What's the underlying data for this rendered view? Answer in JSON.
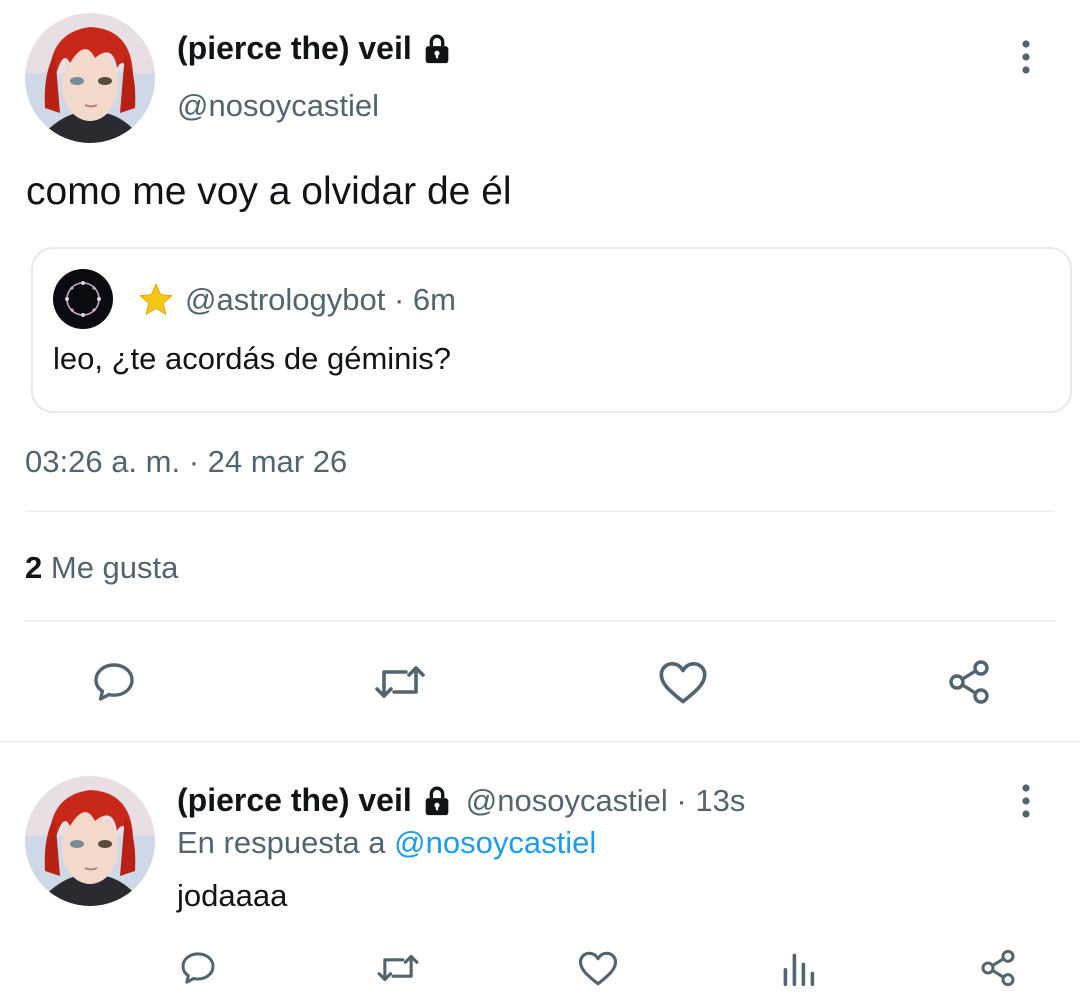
{
  "main_tweet": {
    "display_name": "(pierce the) veil",
    "handle": "@nosoycastiel",
    "text": "como me voy a olvidar de él",
    "quoted": {
      "handle_time": "@astrologybot · 6m",
      "text": "leo, ¿te acordás de géminis?"
    },
    "timestamp": "03:26 a. m. · 24 mar 26",
    "likes_count": "2",
    "likes_label": "Me gusta",
    "actions": [
      "reply-icon",
      "retweet-icon",
      "like-icon",
      "share-icon"
    ]
  },
  "reply_tweet": {
    "display_name": "(pierce the) veil",
    "handle_time": "@nosoycastiel · 13s",
    "reply_prefix": "En respuesta a",
    "reply_mention": "@nosoycastiel",
    "text": "jodaaaa",
    "actions": [
      "reply-icon",
      "retweet-icon",
      "like-icon",
      "views-icon",
      "share-icon"
    ]
  },
  "colors": {
    "primary_text": "#0f1419",
    "secondary_text": "#536471",
    "link": "#1d9bf0",
    "divider": "#eff3f4",
    "icon": "#536471",
    "star": "#f5c518"
  }
}
